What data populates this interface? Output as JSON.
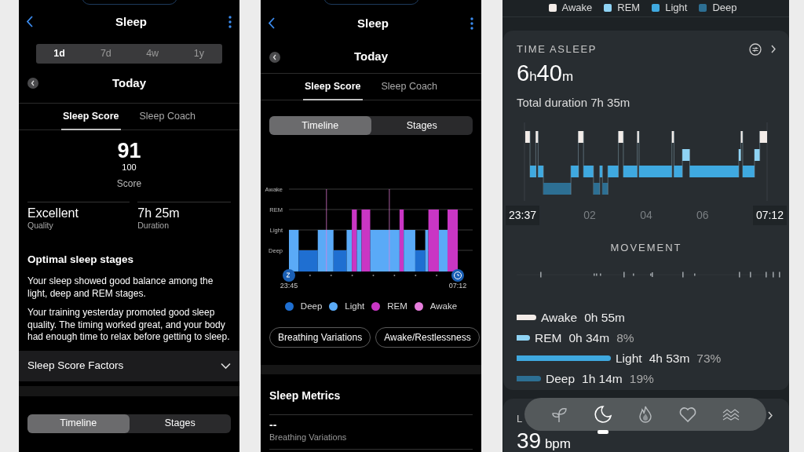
{
  "left_screen": {
    "title": "Sleep",
    "range_tabs": [
      {
        "label": "1d",
        "selected": true
      },
      {
        "label": "7d",
        "selected": false
      },
      {
        "label": "4w",
        "selected": false
      },
      {
        "label": "1y",
        "selected": false
      }
    ],
    "date": "Today",
    "tabs": [
      {
        "label": "Sleep Score",
        "selected": true
      },
      {
        "label": "Sleep Coach",
        "selected": false
      }
    ],
    "score": {
      "value": "91",
      "max": "100",
      "label": "Score"
    },
    "stats": [
      {
        "value": "Excellent",
        "label": "Quality"
      },
      {
        "value": "7h 25m",
        "label": "Duration"
      }
    ],
    "insight": {
      "title": "Optimal sleep stages",
      "paragraphs": [
        "Your sleep showed good balance among the light, deep and REM stages.",
        "Your training yesterday promoted good sleep quality. The timing worked great, and your body had enough time to relax before getting to sleep."
      ]
    },
    "factors": {
      "label": "Sleep Score Factors",
      "expanded": false
    },
    "view_toggle": [
      {
        "label": "Timeline",
        "selected": true
      },
      {
        "label": "Stages",
        "selected": false
      }
    ]
  },
  "middle_screen": {
    "title": "Sleep",
    "date": "Today",
    "tabs": [
      {
        "label": "Sleep Score",
        "selected": true
      },
      {
        "label": "Sleep Coach",
        "selected": false
      }
    ],
    "view_toggle": [
      {
        "label": "Timeline",
        "selected": true
      },
      {
        "label": "Stages",
        "selected": false
      }
    ],
    "chart": {
      "y_labels": [
        "Awake",
        "REM",
        "Light",
        "Deep"
      ],
      "start": "23:45",
      "end": "07:12"
    },
    "legend": [
      {
        "label": "Deep",
        "color": "#1f6fd1"
      },
      {
        "label": "Light",
        "color": "#5aaaf7"
      },
      {
        "label": "REM",
        "color": "#c936c4"
      },
      {
        "label": "Awake",
        "color": "#e67ddc"
      }
    ],
    "chips": [
      "Breathing Variations",
      "Awake/Restlessness"
    ],
    "metrics": {
      "title": "Sleep Metrics",
      "items": [
        {
          "value": "--",
          "label": "Breathing Variations"
        }
      ]
    }
  },
  "right_screen": {
    "legend": [
      {
        "label": "Awake",
        "color": "#f3ece8"
      },
      {
        "label": "REM",
        "color": "#8fd3f4"
      },
      {
        "label": "Light",
        "color": "#3fa9e0"
      },
      {
        "label": "Deep",
        "color": "#2d6f93"
      }
    ],
    "card": {
      "title": "TIME ASLEEP",
      "hours": "6",
      "hours_unit": "h",
      "minutes": "40",
      "minutes_unit": "m",
      "total": "Total duration 7h 35m",
      "axis": [
        "23:37",
        "02",
        "04",
        "06",
        "07:12"
      ],
      "movement_title": "MOVEMENT",
      "stages": [
        {
          "label": "Awake",
          "duration": "0h 55m",
          "color": "#f3ece8"
        },
        {
          "label": "REM",
          "duration": "0h 34m",
          "percent": "8%",
          "color": "#8fd3f4"
        },
        {
          "label": "Light",
          "duration": "4h 53m",
          "percent": "73%",
          "color": "#3fa9e0"
        },
        {
          "label": "Deep",
          "duration": "1h 14m",
          "percent": "19%",
          "color": "#2d6f93"
        }
      ]
    },
    "next_card": {
      "title": "L",
      "value": "39",
      "unit": "bpm"
    },
    "nav": [
      {
        "kind": "sprout",
        "selected": false
      },
      {
        "kind": "moon",
        "selected": true
      },
      {
        "kind": "flame",
        "selected": false
      },
      {
        "kind": "heart",
        "selected": false
      },
      {
        "kind": "waves",
        "selected": false
      }
    ]
  }
}
